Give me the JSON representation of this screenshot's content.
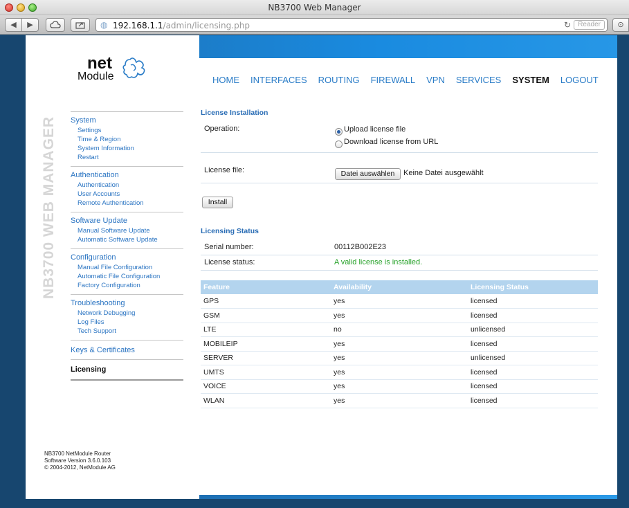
{
  "window": {
    "title": "NB3700 Web Manager"
  },
  "browser": {
    "url_host": "192.168.1.1",
    "url_path": "/admin/licensing.php",
    "reader_label": "Reader"
  },
  "brand": {
    "logo_net": "net",
    "logo_module": "Module",
    "vertical_title": "NB3700 WEB MANAGER"
  },
  "topnav": {
    "items": [
      "HOME",
      "INTERFACES",
      "ROUTING",
      "FIREWALL",
      "VPN",
      "SERVICES",
      "SYSTEM",
      "LOGOUT"
    ],
    "active": "SYSTEM"
  },
  "sidebar": {
    "groups": [
      {
        "title": "System",
        "items": [
          "Settings",
          "Time & Region",
          "System Information",
          "Restart"
        ]
      },
      {
        "title": "Authentication",
        "items": [
          "Authentication",
          "User Accounts",
          "Remote Authentication"
        ]
      },
      {
        "title": "Software Update",
        "items": [
          "Manual Software Update",
          "Automatic Software Update"
        ]
      },
      {
        "title": "Configuration",
        "items": [
          "Manual File Configuration",
          "Automatic File Configuration",
          "Factory Configuration"
        ]
      },
      {
        "title": "Troubleshooting",
        "items": [
          "Network Debugging",
          "Log Files",
          "Tech Support"
        ]
      }
    ],
    "keys": "Keys & Certificates",
    "licensing": "Licensing"
  },
  "footer": {
    "line1": "NB3700 NetModule Router",
    "line2": "Software Version 3.6.0.103",
    "line3": "© 2004-2012, NetModule AG"
  },
  "installation": {
    "title": "License Installation",
    "operation_label": "Operation:",
    "option_upload": "Upload license file",
    "option_download": "Download license from URL",
    "selected_option": "upload",
    "file_label": "License file:",
    "file_button": "Datei auswählen",
    "file_status": "Keine Datei ausgewählt",
    "install_button": "Install"
  },
  "status": {
    "title": "Licensing Status",
    "serial_label": "Serial number:",
    "serial_value": "00112B002E23",
    "license_label": "License status:",
    "license_value": "A valid license is installed.",
    "license_color": "#27a22a"
  },
  "features_table": {
    "headers": [
      "Feature",
      "Availability",
      "Licensing Status"
    ],
    "rows": [
      [
        "GPS",
        "yes",
        "licensed"
      ],
      [
        "GSM",
        "yes",
        "licensed"
      ],
      [
        "LTE",
        "no",
        "unlicensed"
      ],
      [
        "MOBILEIP",
        "yes",
        "licensed"
      ],
      [
        "SERVER",
        "yes",
        "unlicensed"
      ],
      [
        "UMTS",
        "yes",
        "licensed"
      ],
      [
        "VOICE",
        "yes",
        "licensed"
      ],
      [
        "WLAN",
        "yes",
        "licensed"
      ]
    ]
  }
}
